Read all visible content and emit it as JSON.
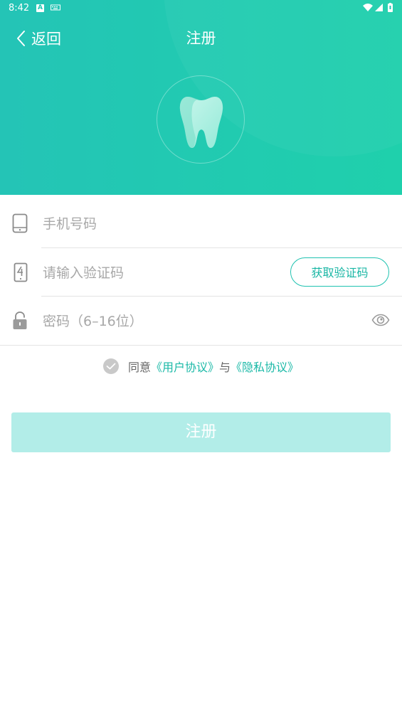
{
  "status_bar": {
    "time": "8:42",
    "notification_letter": "A"
  },
  "header": {
    "back_label": "返回",
    "title": "注册"
  },
  "form": {
    "phone": {
      "placeholder": "手机号码",
      "value": ""
    },
    "code": {
      "placeholder": "请输入验证码",
      "value": "",
      "button_label": "获取验证码"
    },
    "password": {
      "placeholder": "密码（6–16位）",
      "value": ""
    }
  },
  "agreement": {
    "prefix": "同意",
    "user_agreement": "《用户协议》",
    "conjunction": "与",
    "privacy_policy": "《隐私协议》",
    "checked": false
  },
  "submit_label": "注册",
  "colors": {
    "header_gradient_start": "#24c4b6",
    "header_gradient_end": "#1fd0ac",
    "accent": "#1ab9a7",
    "submit_disabled": "#b2ede8"
  },
  "icons": {
    "back": "chevron-left-icon",
    "logo": "tooth-icon",
    "phone": "phone-icon",
    "code": "sms-code-icon",
    "password": "lock-icon",
    "toggle_password": "eye-icon",
    "checkbox": "check-icon"
  }
}
